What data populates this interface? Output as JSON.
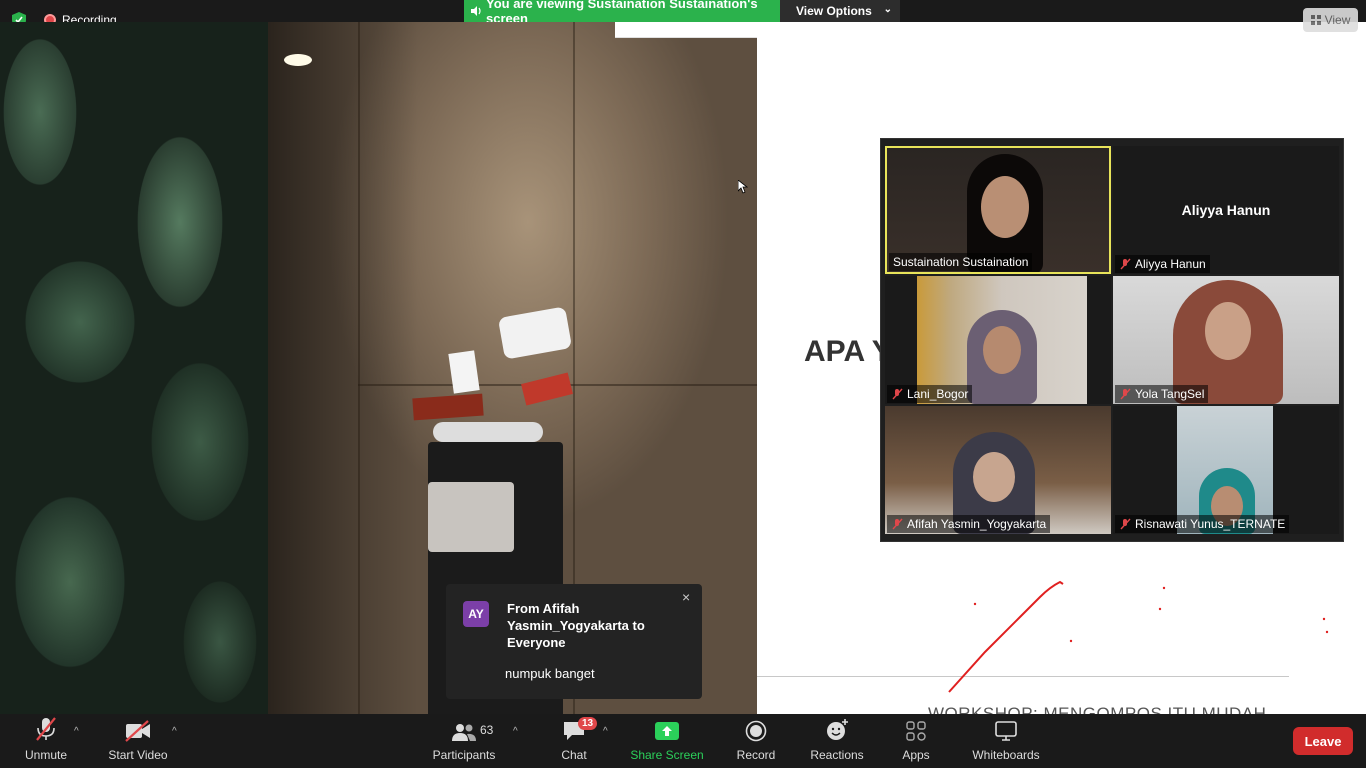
{
  "topbar": {
    "recording_label": "Recording",
    "viewing_banner": "You are viewing Sustaination Sustaination's screen",
    "view_options_label": "View Options",
    "view_label": "View"
  },
  "shared_screen": {
    "slide_title": "APA Y",
    "slide_footer": "WORKSHOP: MENGOMPOS ITU MUDAH"
  },
  "gallery": {
    "tiles": [
      {
        "name": "Sustaination Sustaination",
        "active": true,
        "muted": false,
        "video": true
      },
      {
        "name": "Aliyya Hanun",
        "active": false,
        "muted": true,
        "video": false,
        "big_name": "Aliyya Hanun"
      },
      {
        "name": "Lani_Bogor",
        "active": false,
        "muted": true,
        "video": true
      },
      {
        "name": "Yola TangSel",
        "active": false,
        "muted": true,
        "video": true
      },
      {
        "name": "Afifah Yasmin_Yogyakarta",
        "active": false,
        "muted": true,
        "video": true
      },
      {
        "name": "Risnawati Yunus_TERNATE",
        "active": false,
        "muted": true,
        "video": true
      }
    ]
  },
  "chat_popup": {
    "avatar_initials": "AY",
    "from": "From Afifah Yasmin_Yogyakarta to Everyone",
    "message": "numpuk banget",
    "close": "×"
  },
  "toolbar": {
    "unmute": "Unmute",
    "start_video": "Start Video",
    "participants": "Participants",
    "participants_count": "63",
    "chat": "Chat",
    "chat_badge": "13",
    "share_screen": "Share Screen",
    "record": "Record",
    "reactions": "Reactions",
    "apps": "Apps",
    "whiteboards": "Whiteboards",
    "leave": "Leave"
  },
  "colors": {
    "banner_green": "#2bb24c",
    "leave_red": "#d12c2c",
    "active_speaker": "#e8e45a",
    "chat_avatar": "#7c3fa8"
  }
}
